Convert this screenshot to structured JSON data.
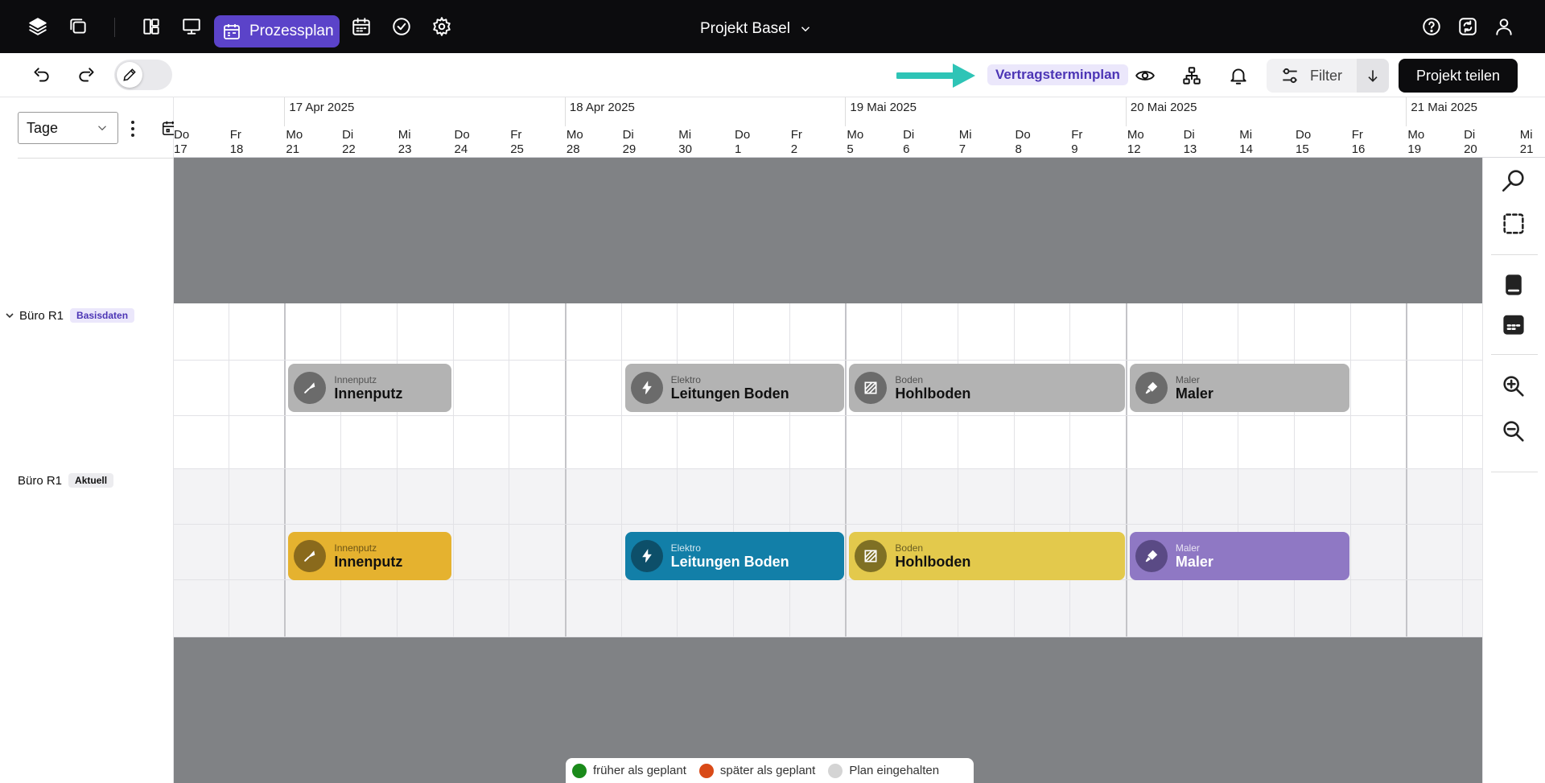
{
  "topbar": {
    "active_tab_label": "Prozessplan",
    "project_name": "Projekt Basel",
    "icons": [
      "layers-icon",
      "copy-icon",
      "dashboard-icon",
      "presentation-icon",
      "calendar-icon",
      "calendar-icon",
      "check-circle-icon",
      "gear-icon",
      "help-icon",
      "sync-icon",
      "user-icon"
    ]
  },
  "toolbar": {
    "plan_label": "Vertragsterminplan",
    "filter_label": "Filter",
    "share_label": "Projekt teilen",
    "accent_color": "#2ec4b6"
  },
  "left": {
    "scale_value": "Tage",
    "rows": [
      {
        "name": "Büro R1",
        "tag": "Basisdaten"
      },
      {
        "name": "Büro R1",
        "tag": "Aktuell"
      }
    ]
  },
  "timeline": {
    "weeks": [
      {
        "label": "17 Apr 2025"
      },
      {
        "label": "18 Apr 2025"
      },
      {
        "label": "19 Mai 2025"
      },
      {
        "label": "20 Mai 2025"
      },
      {
        "label": "21 Mai 2025"
      }
    ],
    "days": [
      {
        "dow": "Do",
        "num": "17"
      },
      {
        "dow": "Fr",
        "num": "18"
      },
      {
        "dow": "Mo",
        "num": "21"
      },
      {
        "dow": "Di",
        "num": "22"
      },
      {
        "dow": "Mi",
        "num": "23"
      },
      {
        "dow": "Do",
        "num": "24"
      },
      {
        "dow": "Fr",
        "num": "25"
      },
      {
        "dow": "Mo",
        "num": "28"
      },
      {
        "dow": "Di",
        "num": "29"
      },
      {
        "dow": "Mi",
        "num": "30"
      },
      {
        "dow": "Do",
        "num": "1"
      },
      {
        "dow": "Fr",
        "num": "2"
      },
      {
        "dow": "Mo",
        "num": "5"
      },
      {
        "dow": "Di",
        "num": "6"
      },
      {
        "dow": "Mi",
        "num": "7"
      },
      {
        "dow": "Do",
        "num": "8"
      },
      {
        "dow": "Fr",
        "num": "9"
      },
      {
        "dow": "Mo",
        "num": "12"
      },
      {
        "dow": "Di",
        "num": "13"
      },
      {
        "dow": "Mi",
        "num": "14"
      },
      {
        "dow": "Do",
        "num": "15"
      },
      {
        "dow": "Fr",
        "num": "16"
      },
      {
        "dow": "Mo",
        "num": "19"
      },
      {
        "dow": "Di",
        "num": "20"
      },
      {
        "dow": "Mi",
        "num": "21"
      }
    ]
  },
  "tasks_base": [
    {
      "trade": "Innenputz",
      "name": "Innenputz",
      "icon": "trowel-icon",
      "color": "#b3b3b3",
      "icon_bg": "#6b6b6b"
    },
    {
      "trade": "Elektro",
      "name": "Leitungen Boden",
      "icon": "lightning-icon",
      "color": "#b3b3b3",
      "icon_bg": "#6b6b6b"
    },
    {
      "trade": "Boden",
      "name": "Hohlboden",
      "icon": "floor-icon",
      "color": "#b3b3b3",
      "icon_bg": "#6b6b6b"
    },
    {
      "trade": "Maler",
      "name": "Maler",
      "icon": "paint-icon",
      "color": "#b3b3b3",
      "icon_bg": "#6b6b6b"
    }
  ],
  "tasks_current": [
    {
      "trade": "Innenputz",
      "name": "Innenputz",
      "icon": "trowel-icon",
      "color": "#e5b22f",
      "icon_bg": "#8a6a1c"
    },
    {
      "trade": "Elektro",
      "name": "Leitungen Boden",
      "icon": "lightning-icon",
      "color": "#127fa8",
      "icon_bg": "#0d4f69"
    },
    {
      "trade": "Boden",
      "name": "Hohlboden",
      "icon": "floor-icon",
      "color": "#e3c94c",
      "icon_bg": "#7f7024"
    },
    {
      "trade": "Maler",
      "name": "Maler",
      "icon": "paint-icon",
      "color": "#8f78c4",
      "icon_bg": "#5a4a85"
    }
  ],
  "legend": {
    "items": [
      {
        "label": "früher als geplant",
        "color": "#1a8a1a"
      },
      {
        "label": "später als geplant",
        "color": "#d94a17"
      },
      {
        "label": "Plan eingehalten",
        "color": "#d4d4d4"
      }
    ]
  }
}
